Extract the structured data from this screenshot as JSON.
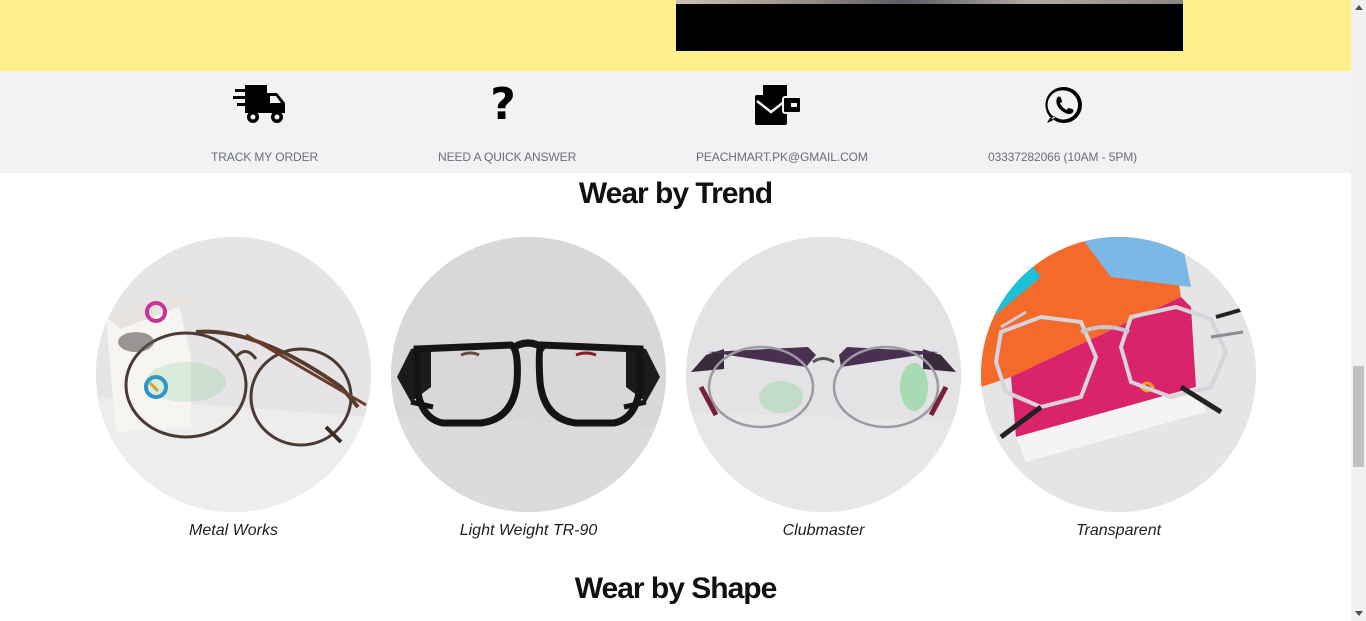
{
  "info_bar": {
    "items": [
      {
        "label": "TRACK MY ORDER",
        "icon": "truck-icon"
      },
      {
        "label": "NEED A QUICK ANSWER",
        "icon": "question-icon",
        "glyph": "?"
      },
      {
        "label": "PEACHMART.PK@GMAIL.COM",
        "icon": "mail-icon"
      },
      {
        "label": "03337282066 (10AM - 5PM)",
        "icon": "whatsapp-icon"
      }
    ]
  },
  "sections": {
    "trend_title": "Wear by Trend",
    "shape_title": "Wear by Shape"
  },
  "trends": [
    {
      "label": "Metal Works"
    },
    {
      "label": "Light Weight TR-90"
    },
    {
      "label": "Clubmaster"
    },
    {
      "label": "Transparent"
    }
  ],
  "colors": {
    "hero_bg": "#fef08a",
    "info_bg": "#f1f2f4",
    "label_gray": "#6b6e75"
  }
}
